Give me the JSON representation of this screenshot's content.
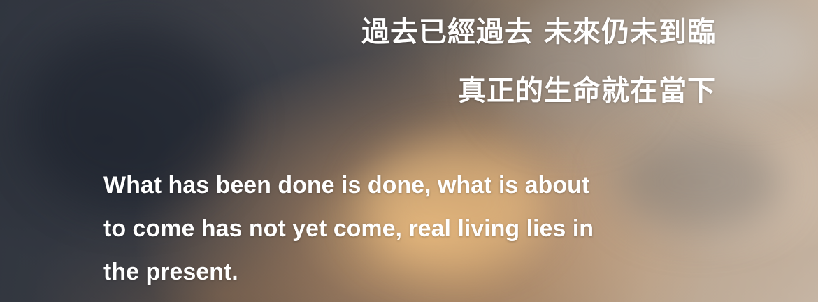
{
  "quote": {
    "zh_line1": "過去已經過去  未來仍未到臨",
    "zh_line2": "真正的生命就在當下",
    "en_lines": [
      "What has been done is done, what is about",
      "to come has not yet come, real living lies in",
      "the present."
    ]
  },
  "colors": {
    "text": "#ffffff",
    "sky_dark": "#2f343d",
    "sky_warm": "#d9ab78"
  }
}
